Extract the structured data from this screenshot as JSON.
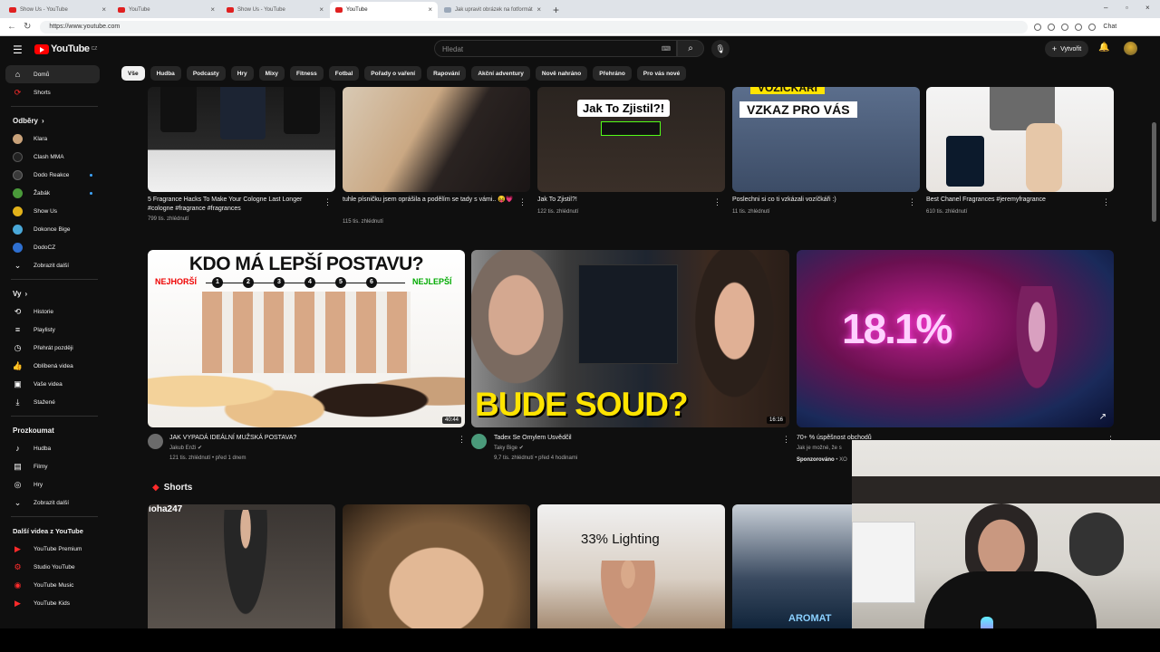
{
  "browser": {
    "tabs": [
      {
        "title": "Show Us - YouTube",
        "fav": "youtube-icon",
        "active": false
      },
      {
        "title": "YouTube",
        "fav": "youtube-icon",
        "active": false
      },
      {
        "title": "Show Us - YouTube",
        "fav": "youtube-icon",
        "active": false
      },
      {
        "title": "YouTube",
        "fav": "youtube-icon",
        "active": true
      },
      {
        "title": "Jak upravit obrázek na fotformát",
        "fav": "doc-icon",
        "active": false
      }
    ],
    "url": "https://www.youtube.com",
    "chat_label": "Chat"
  },
  "header": {
    "logo_text": "YouTube",
    "logo_region": "CZ",
    "search_placeholder": "Hledat",
    "create_label": "Vytvořit"
  },
  "chips": [
    "Vše",
    "Hudba",
    "Podcasty",
    "Hry",
    "Mixy",
    "Fitness",
    "Fotbal",
    "Pořady o vaření",
    "Rapování",
    "Akční adventury",
    "Nově nahráno",
    "Přehráno",
    "Pro vás nové"
  ],
  "sidebar": {
    "home": "Domů",
    "shorts": "Shorts",
    "subscriptions_title": "Odběry",
    "subscriptions": [
      {
        "name": "Klara",
        "color": "#c9a27a",
        "dot": false
      },
      {
        "name": "Clash MMA",
        "color": "#222222",
        "dot": false
      },
      {
        "name": "Dodo Reakce",
        "color": "#3a3a3a",
        "dot": true
      },
      {
        "name": "Žabák",
        "color": "#4a9a3a",
        "dot": true
      },
      {
        "name": "Show Us",
        "color": "#e2b21a",
        "dot": false
      },
      {
        "name": "Dokonce Bige",
        "color": "#4aa8d8",
        "dot": false
      },
      {
        "name": "DodoCZ",
        "color": "#2e6fd0",
        "dot": false
      }
    ],
    "show_more": "Zobrazit další",
    "you_title": "Vy",
    "you_items": [
      {
        "label": "Historie",
        "icon": "history-icon"
      },
      {
        "label": "Playlisty",
        "icon": "playlist-icon"
      },
      {
        "label": "Přehrát později",
        "icon": "clock-icon"
      },
      {
        "label": "Oblíbená videa",
        "icon": "thumb-up-icon"
      },
      {
        "label": "Vaše videa",
        "icon": "video-icon"
      },
      {
        "label": "Stažené",
        "icon": "download-icon"
      }
    ],
    "explore_title": "Prozkoumat",
    "explore_items": [
      {
        "label": "Hudba",
        "icon": "music-icon"
      },
      {
        "label": "Filmy",
        "icon": "film-icon"
      },
      {
        "label": "Hry",
        "icon": "game-icon"
      },
      {
        "label": "Zobrazit další",
        "icon": "chevron-down-icon"
      }
    ],
    "more_title": "Další videa z YouTube",
    "more_items": [
      "YouTube Premium",
      "Studio YouTube",
      "YouTube Music",
      "YouTube Kids"
    ]
  },
  "row1": [
    {
      "title": "5 Fragrance Hacks To Make Your Cologne Last Longer #cologne #fragrance #fragrances",
      "views": "799 tis. zhlédnutí"
    },
    {
      "title": "tuhle písničku jsem oprášila a podělím se tady s vámi.. 😝💗",
      "views": "115 tis. zhlédnutí"
    },
    {
      "title": "Jak To Zjistil?!",
      "views": "122 tis. zhlédnutí",
      "overlay": "Jak To Zjistil?!"
    },
    {
      "title": "Poslechni si co ti vzkázali vozíčkáři :)",
      "views": "11 tis. zhlédnutí",
      "overlay": "VZKAZ PRO VÁS",
      "overlay_top": "VOZÍČKÁŘI"
    },
    {
      "title": "Best Chanel Fragrances #jeremyfragrance",
      "views": "610 tis. zhlédnutí"
    }
  ],
  "row2": [
    {
      "title": "JAK VYPADÁ IDEÁLNÍ MUŽSKÁ POSTAVA?",
      "channel": "Jakub Enži",
      "meta": "121 tis. zhlédnutí • před 1 dnem",
      "duration": "40:44",
      "overlay": "KDO MÁ LEPŠÍ POSTAVU?",
      "worst": "NEJHORŠÍ",
      "best": "NEJLEPŠÍ",
      "ranks": [
        "1",
        "2",
        "3",
        "4",
        "5",
        "6"
      ]
    },
    {
      "title": "Tadex Se Omylem Usvědčil",
      "channel": "Taky Bige",
      "meta": "9,7 tis. zhlédnutí • před 4 hodinami",
      "duration": "16:16",
      "overlay": "BUDE SOUD?"
    },
    {
      "title": "70+ % úspěšnost obchodů",
      "desc": "Jak je možné, že s",
      "sponsored": "Sponzorováno",
      "sponsor_tail": "XO",
      "overlay": "18.1%"
    }
  ],
  "shorts": {
    "title": "Shorts",
    "items": [
      {
        "overlay": "ioha247"
      },
      {
        "overlay": ""
      },
      {
        "overlay": "33% Lighting"
      },
      {
        "overlay": "AROMAT"
      }
    ]
  },
  "colors": {
    "yt_red": "#ff0000",
    "bg": "#0f0f0f",
    "chip_selected": "#f1f1f1",
    "chip": "#272727"
  }
}
